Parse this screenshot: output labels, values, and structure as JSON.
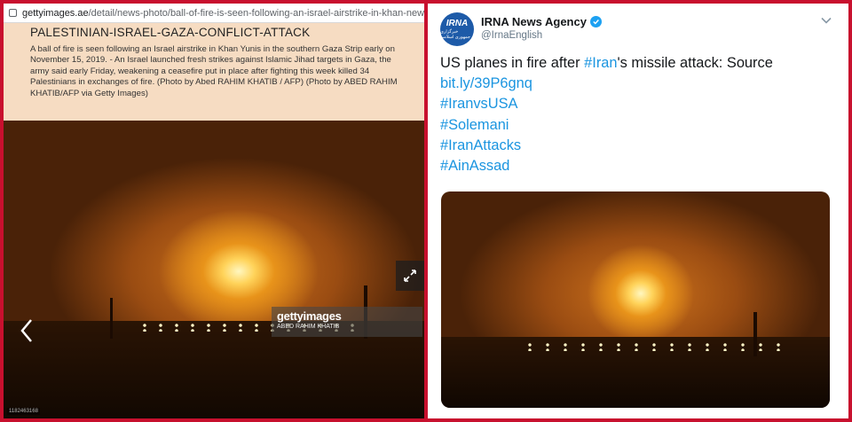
{
  "left_panel": {
    "url": {
      "domain": "gettyimages.ae",
      "path": "/detail/news-photo/ball-of-fire-is-seen-following-an-israel-airstrike-in-khan-new"
    },
    "caption": {
      "title": "PALESTINIAN-ISRAEL-GAZA-CONFLICT-ATTACK",
      "text": "A ball of fire is seen following an Israel airstrike in Khan Yunis in the southern Gaza Strip early on November 15, 2019. - An Israel launched fresh strikes against Islamic Jihad targets in Gaza, the army said early Friday, weakening a ceasefire put in place after fighting this week killed 34 Palestinians in exchanges of fire. (Photo by Abed RAHIM KHATIB / AFP) (Photo by ABED RAHIM KHATIB/AFP via Getty Images)"
    },
    "watermark": {
      "brand": "gettyimages",
      "credit": "ABED RAHIM KHATIB"
    },
    "image_id": "1182463168"
  },
  "tweet": {
    "display_name": "IRNA News Agency",
    "handle": "@IrnaEnglish",
    "avatar_text": "IRNA",
    "avatar_subtext": "خبرگزاری جمهوری اسلامی",
    "text_lines": {
      "l1_prefix": "US planes in fire after ",
      "l1_tag": "#Iran",
      "l1_suffix": "'s missile attack: Source",
      "link": "bit.ly/39P6gnq",
      "tag1": "#IranvsUSA",
      "tag2": "#Solemani",
      "tag3": "#IranAttacks",
      "tag4": "#AinAssad"
    }
  },
  "colors": {
    "frame": "#c8102e",
    "link": "#1b95e0",
    "verified": "#1da1f2"
  },
  "icons": [
    "lock-icon",
    "expand-icon",
    "chevron-left-icon",
    "verified-icon",
    "chevron-down-icon"
  ]
}
